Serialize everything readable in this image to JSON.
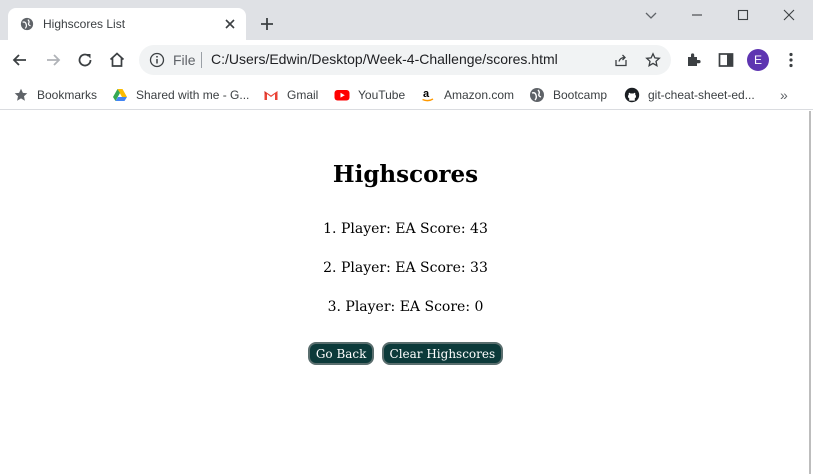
{
  "browser": {
    "tab": {
      "title": "Highscores List"
    },
    "address": {
      "scheme": "File",
      "url": "C:/Users/Edwin/Desktop/Week-4-Challenge/scores.html"
    },
    "profile_initial": "E",
    "profile_color": "#5e35b1",
    "bookmarks": [
      {
        "label": "Bookmarks",
        "icon": "star-icon"
      },
      {
        "label": "Shared with me - G...",
        "icon": "google-drive-icon"
      },
      {
        "label": "Gmail",
        "icon": "gmail-icon"
      },
      {
        "label": "YouTube",
        "icon": "youtube-icon"
      },
      {
        "label": "Amazon.com",
        "icon": "amazon-icon"
      },
      {
        "label": "Bootcamp",
        "icon": "globe-icon"
      },
      {
        "label": "git-cheat-sheet-ed...",
        "icon": "github-icon"
      }
    ],
    "more_bookmarks": "»"
  },
  "page": {
    "title": "Highscores",
    "scores": [
      "1. Player: EA Score: 43",
      "2. Player: EA Score: 33",
      "3. Player: EA Score: 0"
    ],
    "buttons": {
      "back": "Go Back",
      "clear": "Clear Highscores"
    },
    "button_color": "#0c3a3a"
  }
}
